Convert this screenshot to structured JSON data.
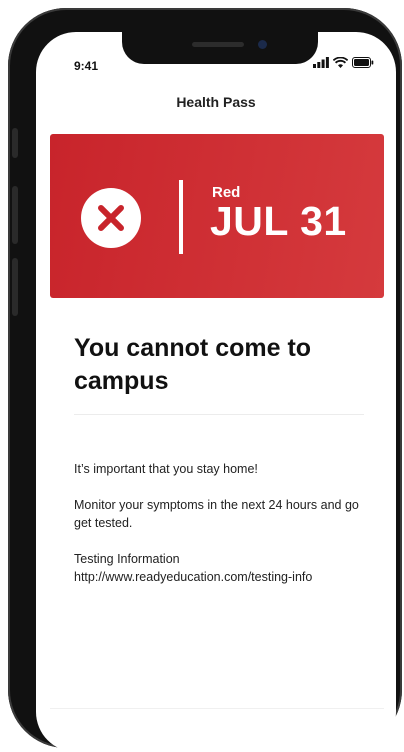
{
  "status_bar": {
    "time": "9:41"
  },
  "header": {
    "title": "Health Pass"
  },
  "banner": {
    "status_label": "Red",
    "date": "JUL 31",
    "color": "#c8242b"
  },
  "message": {
    "headline": "You cannot come to campus",
    "line1": "It’s important that you stay home!",
    "line2": "Monitor your symptoms in the next 24 hours and go get tested.",
    "info_title": "Testing Information",
    "info_link": "http://www.readyeducation.com/testing-info"
  },
  "icons": [
    "x-icon",
    "signal-icon",
    "wifi-icon",
    "battery-icon"
  ]
}
